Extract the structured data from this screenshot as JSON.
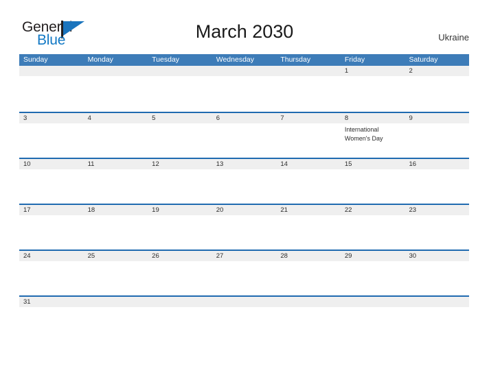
{
  "brand": {
    "word_one": "General",
    "word_two": "Blue",
    "mark_icon": "pennant-triangle-icon"
  },
  "header": {
    "title": "March 2030",
    "locale": "Ukraine"
  },
  "colors": {
    "header_blue": "#3d7cb8",
    "rule_blue": "#1f6ab0",
    "strip_gray": "#efefef",
    "brand_blue": "#1178c4",
    "text_dark": "#231f20"
  },
  "calendar": {
    "weekdays": [
      "Sunday",
      "Monday",
      "Tuesday",
      "Wednesday",
      "Thursday",
      "Friday",
      "Saturday"
    ],
    "weeks": [
      {
        "days": [
          {
            "num": "",
            "event": ""
          },
          {
            "num": "",
            "event": ""
          },
          {
            "num": "",
            "event": ""
          },
          {
            "num": "",
            "event": ""
          },
          {
            "num": "",
            "event": ""
          },
          {
            "num": "1",
            "event": ""
          },
          {
            "num": "2",
            "event": ""
          }
        ]
      },
      {
        "days": [
          {
            "num": "3",
            "event": ""
          },
          {
            "num": "4",
            "event": ""
          },
          {
            "num": "5",
            "event": ""
          },
          {
            "num": "6",
            "event": ""
          },
          {
            "num": "7",
            "event": ""
          },
          {
            "num": "8",
            "event": "International Women's Day"
          },
          {
            "num": "9",
            "event": ""
          }
        ]
      },
      {
        "days": [
          {
            "num": "10",
            "event": ""
          },
          {
            "num": "11",
            "event": ""
          },
          {
            "num": "12",
            "event": ""
          },
          {
            "num": "13",
            "event": ""
          },
          {
            "num": "14",
            "event": ""
          },
          {
            "num": "15",
            "event": ""
          },
          {
            "num": "16",
            "event": ""
          }
        ]
      },
      {
        "days": [
          {
            "num": "17",
            "event": ""
          },
          {
            "num": "18",
            "event": ""
          },
          {
            "num": "19",
            "event": ""
          },
          {
            "num": "20",
            "event": ""
          },
          {
            "num": "21",
            "event": ""
          },
          {
            "num": "22",
            "event": ""
          },
          {
            "num": "23",
            "event": ""
          }
        ]
      },
      {
        "days": [
          {
            "num": "24",
            "event": ""
          },
          {
            "num": "25",
            "event": ""
          },
          {
            "num": "26",
            "event": ""
          },
          {
            "num": "27",
            "event": ""
          },
          {
            "num": "28",
            "event": ""
          },
          {
            "num": "29",
            "event": ""
          },
          {
            "num": "30",
            "event": ""
          }
        ]
      },
      {
        "days": [
          {
            "num": "31",
            "event": ""
          },
          {
            "num": "",
            "event": ""
          },
          {
            "num": "",
            "event": ""
          },
          {
            "num": "",
            "event": ""
          },
          {
            "num": "",
            "event": ""
          },
          {
            "num": "",
            "event": ""
          },
          {
            "num": "",
            "event": ""
          }
        ]
      }
    ]
  }
}
